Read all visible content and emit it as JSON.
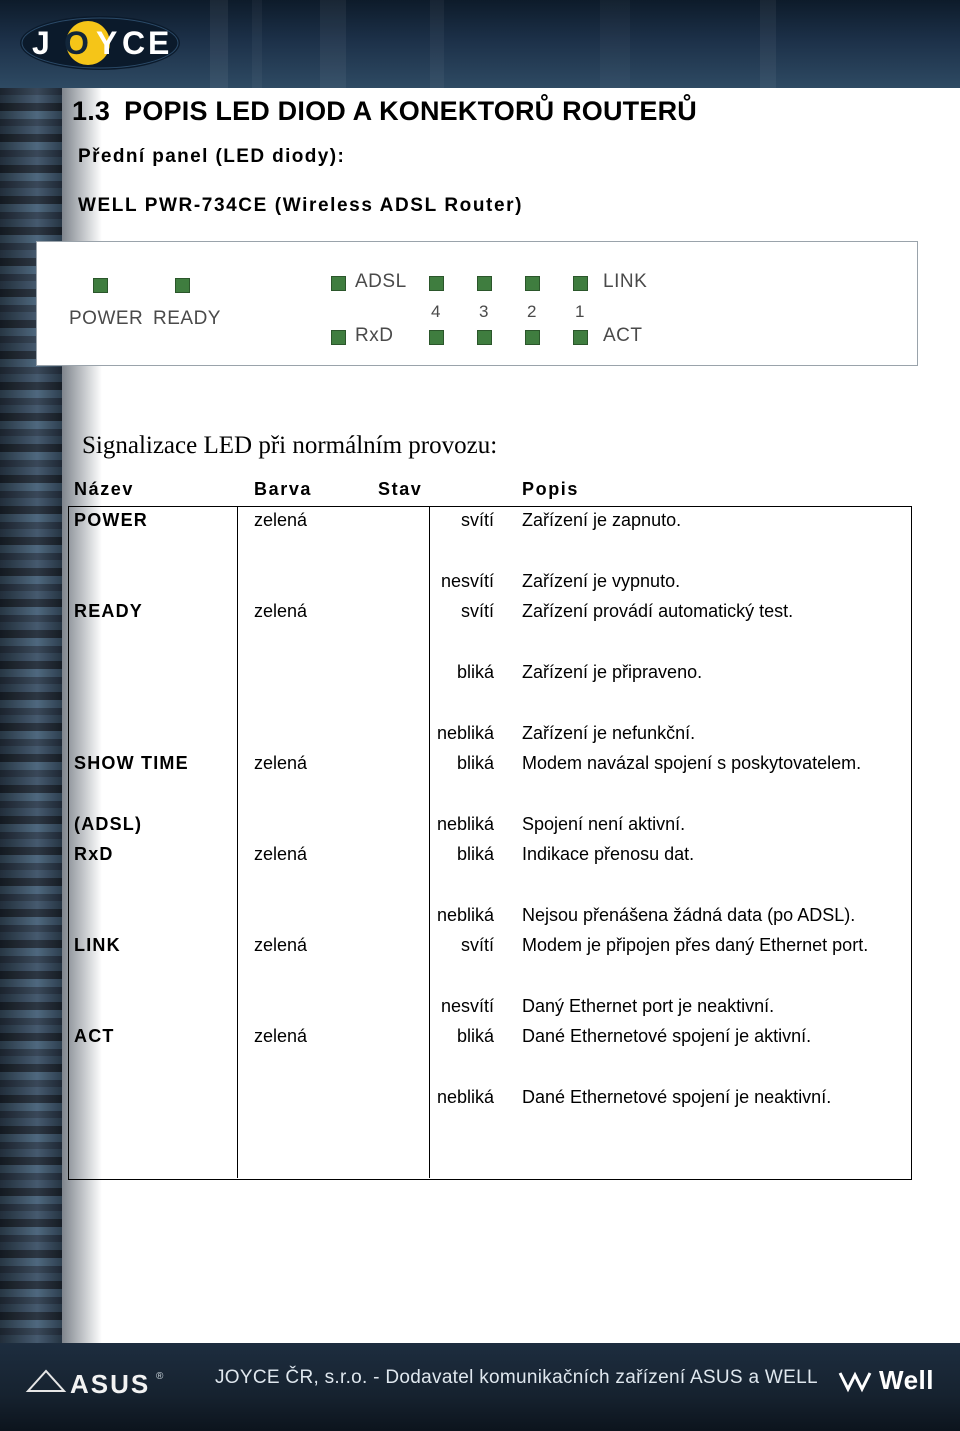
{
  "header": {
    "logo_text": "JOYCE"
  },
  "document": {
    "section_number": "1.3",
    "section_title": "POPIS LED DIOD A KONEKTORŮ ROUTERŮ",
    "subtitle_1": "Přední panel (LED diody):",
    "subtitle_2": "WELL PWR-734CE (Wireless ADSL Router)",
    "panel_caption": "Signalizace LED při normálním provozu:"
  },
  "panel": {
    "labels": {
      "power": "POWER",
      "ready": "READY",
      "adsl": "ADSL",
      "rxd": "RxD",
      "link": "LINK",
      "act": "ACT"
    },
    "port_numbers": [
      "4",
      "3",
      "2",
      "1"
    ]
  },
  "table": {
    "headers": {
      "name": "Název",
      "color": "Barva",
      "state": "Stav",
      "description": "Popis"
    },
    "rows": [
      {
        "name": "POWER",
        "color": "zelená",
        "state": "svítí",
        "description": "Zařízení je zapnuto."
      },
      {
        "name": "",
        "color": "",
        "state": "nesvítí",
        "description": "Zařízení je vypnuto."
      },
      {
        "name": "READY",
        "color": "zelená",
        "state": "svítí",
        "description": "Zařízení provádí automatický test."
      },
      {
        "name": "",
        "color": "",
        "state": "bliká",
        "description": "Zařízení je připraveno."
      },
      {
        "name": "",
        "color": "",
        "state": "nebliká",
        "description": "Zařízení je nefunkční."
      },
      {
        "name": "SHOW TIME",
        "color": "zelená",
        "state": "bliká",
        "description": "Modem navázal spojení s poskytovatelem."
      },
      {
        "name": "(ADSL)",
        "color": "",
        "state": "nebliká",
        "description": "Spojení není aktivní."
      },
      {
        "name": "RxD",
        "color": "zelená",
        "state": "bliká",
        "description": "Indikace přenosu dat."
      },
      {
        "name": "",
        "color": "",
        "state": "nebliká",
        "description": "Nejsou přenášena žádná data (po ADSL)."
      },
      {
        "name": "LINK",
        "color": "zelená",
        "state": "svítí",
        "description": "Modem je připojen přes daný Ethernet port."
      },
      {
        "name": "",
        "color": "",
        "state": "nesvítí",
        "description": "Daný Ethernet port je neaktivní."
      },
      {
        "name": "ACT",
        "color": "zelená",
        "state": "bliká",
        "description": "Dané Ethernetové spojení je aktivní."
      },
      {
        "name": "",
        "color": "",
        "state": "nebliká",
        "description": "Dané Ethernetové spojení je neaktivní."
      }
    ]
  },
  "footer": {
    "text": "JOYCE ČR, s.r.o. - Dodavatel komunikačních zařízení ASUS a WELL",
    "left_logo_text": "ASUS",
    "right_logo_text": "Well"
  }
}
